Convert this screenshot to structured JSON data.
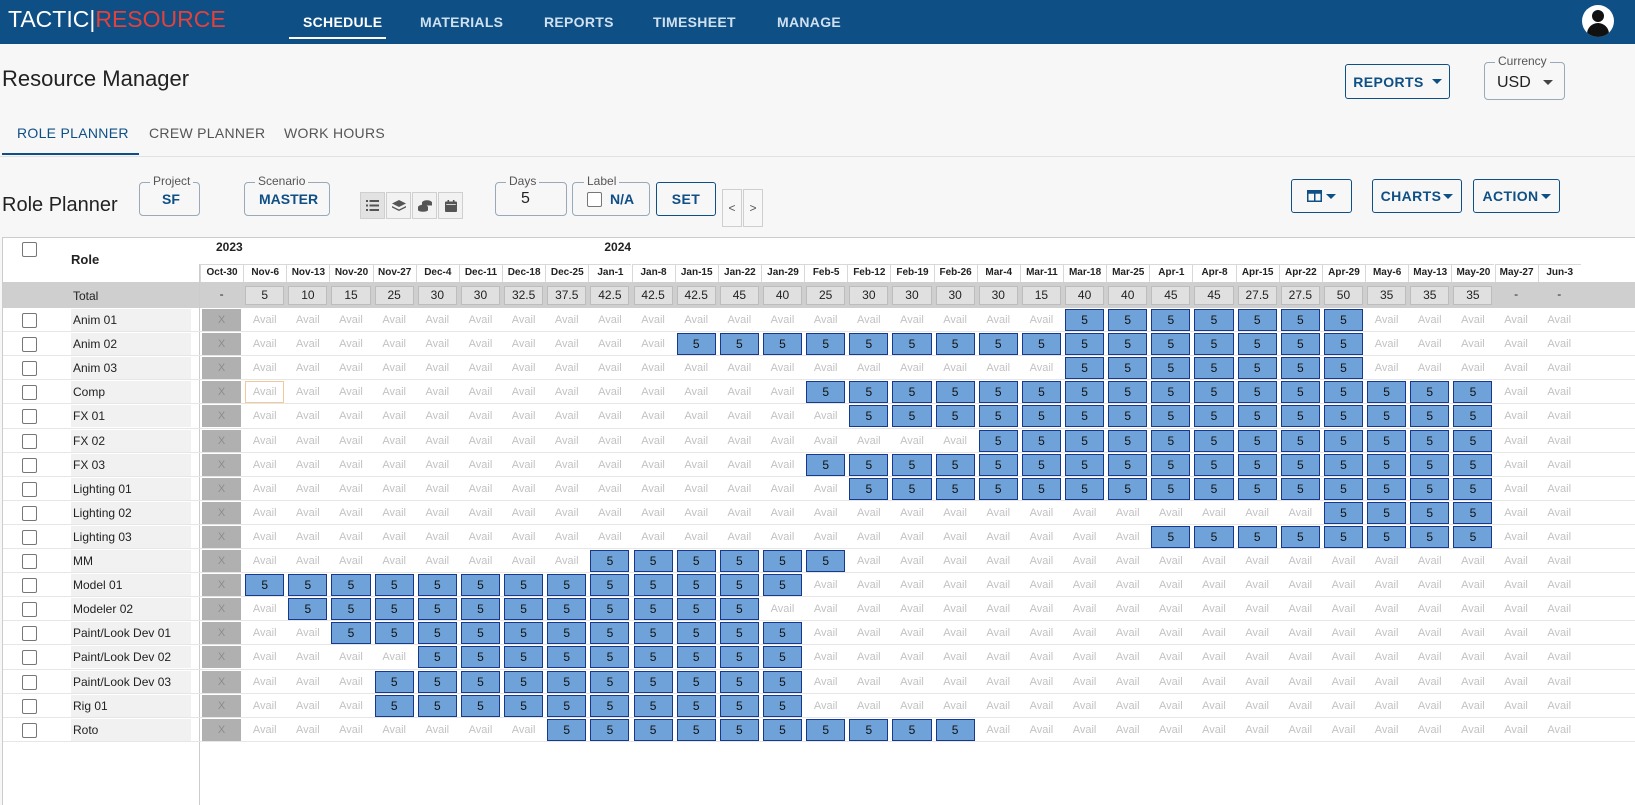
{
  "brand": {
    "part1": "TACTIC",
    "separator": "|",
    "part2": "RESOURCE"
  },
  "nav": {
    "items": [
      "SCHEDULE",
      "MATERIALS",
      "REPORTS",
      "TIMESHEET",
      "MANAGE"
    ],
    "active": "SCHEDULE"
  },
  "page": {
    "title": "Resource Manager",
    "reports_button": "REPORTS",
    "currency_label": "Currency",
    "currency_value": "USD"
  },
  "tabs": {
    "items": [
      "ROLE PLANNER",
      "CREW PLANNER",
      "WORK HOURS"
    ],
    "active": "ROLE PLANNER"
  },
  "toolbar": {
    "title": "Role Planner",
    "project_label": "Project",
    "project_value": "SF",
    "scenario_label": "Scenario",
    "scenario_value": "MASTER",
    "view_icons": [
      "list-icon",
      "layers-icon",
      "coins-icon",
      "calendar-icon"
    ],
    "days_label": "Days",
    "days_value": "5",
    "label_label": "Label",
    "label_value": "N/A",
    "set_button": "SET",
    "prev_label": "<",
    "next_label": ">",
    "columns_icon": "columns-icon",
    "charts_button": "CHARTS",
    "action_button": "ACTION"
  },
  "grid": {
    "role_header": "Role",
    "total_label": "Total",
    "years": [
      "2023",
      "2024"
    ],
    "weeks": [
      "Oct-30",
      "Nov-6",
      "Nov-13",
      "Nov-20",
      "Nov-27",
      "Dec-4",
      "Dec-11",
      "Dec-18",
      "Dec-25",
      "Jan-1",
      "Jan-8",
      "Jan-15",
      "Jan-22",
      "Jan-29",
      "Feb-5",
      "Feb-12",
      "Feb-19",
      "Feb-26",
      "Mar-4",
      "Mar-11",
      "Mar-18",
      "Mar-25",
      "Apr-1",
      "Apr-8",
      "Apr-15",
      "Apr-22",
      "Apr-29",
      "May-6",
      "May-13",
      "May-20",
      "May-27",
      "Jun-3"
    ],
    "totals": [
      "-",
      "5",
      "10",
      "15",
      "25",
      "30",
      "30",
      "32.5",
      "37.5",
      "42.5",
      "42.5",
      "42.5",
      "45",
      "40",
      "25",
      "30",
      "30",
      "30",
      "30",
      "15",
      "40",
      "40",
      "45",
      "45",
      "27.5",
      "27.5",
      "50",
      "35",
      "35",
      "35",
      "-",
      "-"
    ],
    "avail_text": "Avail",
    "x_text": "X",
    "allocation_value": "5",
    "rows": [
      {
        "role": "Anim 01",
        "start": 20,
        "end": 26
      },
      {
        "role": "Anim 02",
        "start": 11,
        "end": 26
      },
      {
        "role": "Anim 03",
        "start": 20,
        "end": 26
      },
      {
        "role": "Comp",
        "start": 14,
        "end": 29,
        "highlight": 1
      },
      {
        "role": "FX 01",
        "start": 15,
        "end": 29
      },
      {
        "role": "FX 02",
        "start": 18,
        "end": 29
      },
      {
        "role": "FX 03",
        "start": 14,
        "end": 29
      },
      {
        "role": "Lighting 01",
        "start": 15,
        "end": 29
      },
      {
        "role": "Lighting 02",
        "start": 26,
        "end": 29
      },
      {
        "role": "Lighting 03",
        "start": 22,
        "end": 29
      },
      {
        "role": "MM",
        "start": 9,
        "end": 14
      },
      {
        "role": "Model 01",
        "start": 1,
        "end": 13
      },
      {
        "role": "Modeler 02",
        "start": 2,
        "end": 12
      },
      {
        "role": "Paint/Look Dev 01",
        "start": 3,
        "end": 13
      },
      {
        "role": "Paint/Look Dev 02",
        "start": 5,
        "end": 13
      },
      {
        "role": "Paint/Look Dev 03",
        "start": 4,
        "end": 13
      },
      {
        "role": "Rig 01",
        "start": 4,
        "end": 13
      },
      {
        "role": "Roto",
        "start": 8,
        "end": 17
      }
    ]
  },
  "colors": {
    "nav_bg": "#0e4f86",
    "brand_red": "#e2413c",
    "allocation_fill": "#6fa2d8",
    "allocation_border": "#18388e",
    "x_cell": "#b0b0b0"
  }
}
